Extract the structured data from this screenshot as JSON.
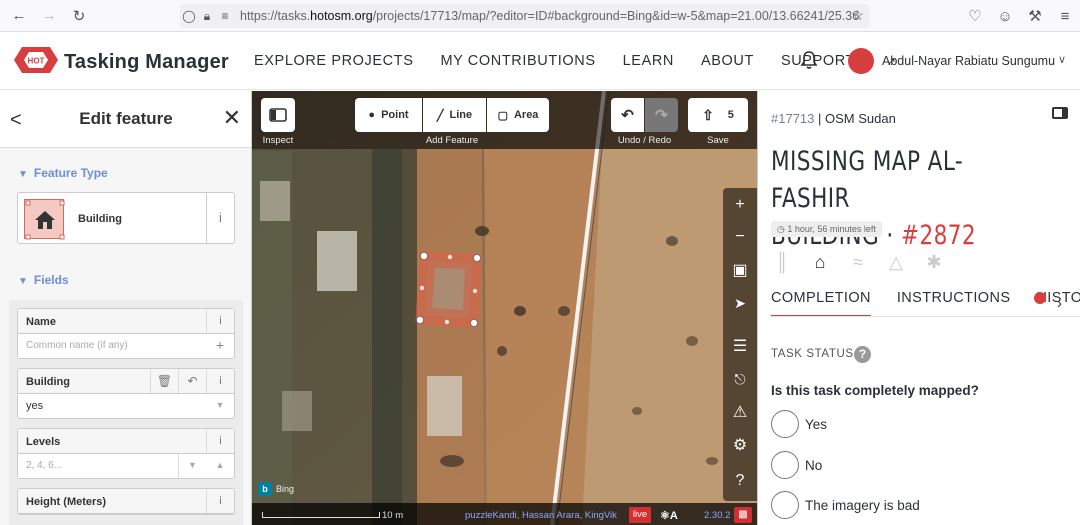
{
  "browser": {
    "url_prefix": "https://tasks.",
    "url_domain": "hotosm.org",
    "url_rest": "/projects/17713/map/?editor=ID#background=Bing&id=w-5&map=21.00/13.66241/25.36"
  },
  "header": {
    "logo_text": "HOT",
    "brand": "Tasking Manager",
    "nav": [
      "EXPLORE PROJECTS",
      "MY CONTRIBUTIONS",
      "LEARN",
      "ABOUT",
      "SUPPORT"
    ],
    "user_name": "Abdul-Nayar Rabiatu Sungumu"
  },
  "editor_panel": {
    "title": "Edit feature",
    "feature_type_heading": "Feature Type",
    "feature_type": "Building",
    "fields_heading": "Fields",
    "fields": [
      {
        "label": "Name",
        "value": "",
        "placeholder": "Common name (if any)"
      },
      {
        "label": "Building",
        "value": "yes",
        "placeholder": ""
      },
      {
        "label": "Levels",
        "value": "",
        "placeholder": "2, 4, 6..."
      },
      {
        "label": "Height (Meters)",
        "value": "",
        "placeholder": ""
      }
    ]
  },
  "map": {
    "modes": [
      "Point",
      "Line",
      "Area"
    ],
    "inspect_label": "Inspect",
    "add_feature_label": "Add Feature",
    "undo_redo_label": "Undo / Redo",
    "save_label": "Save",
    "save_count": "5",
    "scale_text": "10 m",
    "attribution": "puzzleKandi, Hassan Arara, KingVik",
    "live_badge": "live",
    "version": "2.30.2",
    "imagery": "Bing"
  },
  "project": {
    "id": "#17713",
    "org": "OSM Sudan",
    "title_line1": "MISSING MAP AL-FASHIR",
    "title_line2": "BUILDING ·",
    "task_number": "#2872",
    "time_left": "1 hour, 56 minutes left",
    "tabs": [
      "COMPLETION",
      "INSTRUCTIONS",
      "HISTORY"
    ],
    "active_tab": "COMPLETION",
    "task_status_label": "TASK STATUS",
    "question": "Is this task completely mapped?",
    "options": [
      "Yes",
      "No",
      "The imagery is bad"
    ]
  },
  "colors": {
    "brand_red": "#d73f3f",
    "section_blue": "#6c8fd6",
    "feature_fill": "#f5c9c3"
  }
}
